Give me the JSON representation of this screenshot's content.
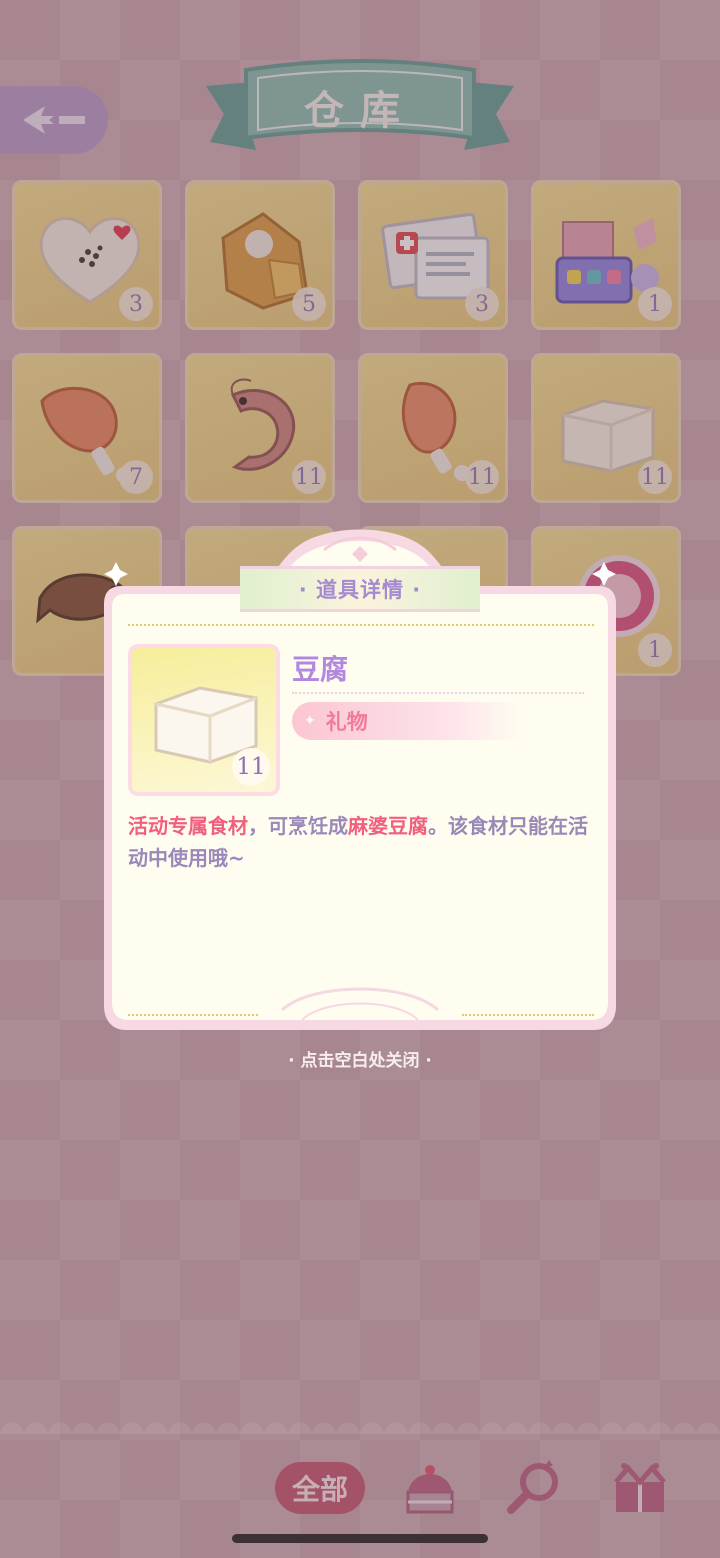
{
  "header": {
    "title": "仓库",
    "back_icon": "back-arrow-icon"
  },
  "inventory": [
    {
      "name": "heart-cookie",
      "icon": "heart-cookie-icon",
      "count": "3"
    },
    {
      "name": "fried-food",
      "icon": "fried-food-icon",
      "count": "5"
    },
    {
      "name": "medical-documents",
      "icon": "medical-documents-icon",
      "count": "3"
    },
    {
      "name": "candy-box",
      "icon": "candy-box-icon",
      "count": "1"
    },
    {
      "name": "chicken-leg",
      "icon": "chicken-leg-icon",
      "count": "7"
    },
    {
      "name": "shrimp",
      "icon": "shrimp-icon",
      "count": "11"
    },
    {
      "name": "chicken-drumstick",
      "icon": "chicken-drumstick-icon",
      "count": "11"
    },
    {
      "name": "tofu",
      "icon": "tofu-icon",
      "count": "11"
    },
    {
      "name": "fish",
      "icon": "fish-icon",
      "count": ""
    },
    {
      "name": "",
      "icon": "",
      "count": ""
    },
    {
      "name": "",
      "icon": "",
      "count": ""
    },
    {
      "name": "badge",
      "icon": "badge-icon",
      "count": "1"
    }
  ],
  "detail": {
    "header": "· 道具详情 ·",
    "item_name": "豆腐",
    "count": "11",
    "tag": "礼物",
    "desc_part1": "活动专属食材",
    "desc_part2": "，可烹饪成",
    "desc_part3": "麻婆豆腐",
    "desc_part4": "。该食材只能在活动中使用哦~"
  },
  "close_hint": "· 点击空白处关闭 ·",
  "bottom_tabs": {
    "all_label": "全部",
    "icons": [
      "cake-icon",
      "magnifier-icon",
      "gift-box-icon"
    ]
  },
  "colors": {
    "accent_pink": "#f0607e",
    "item_name_purple": "#b287e0",
    "tab_active": "#c0506e"
  }
}
